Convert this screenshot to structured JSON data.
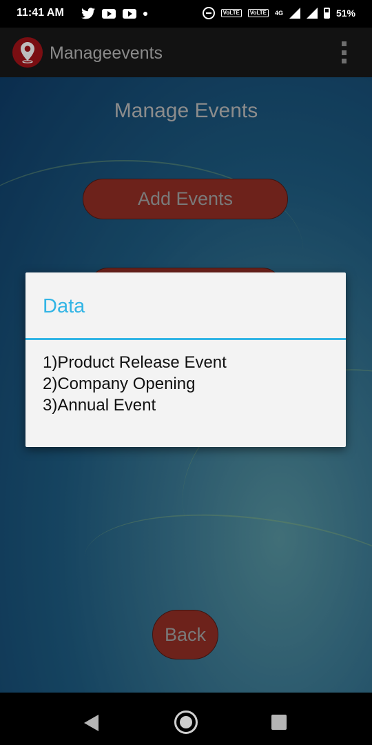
{
  "status_bar": {
    "time": "11:41 AM",
    "battery_text": "51%",
    "network_label": "4G",
    "volte_1": "VoLTE",
    "volte_2": "VoLTE",
    "icons": [
      "twitter-icon",
      "youtube-icon",
      "youtube-icon",
      "notification-dot",
      "do-not-disturb-icon",
      "volte-icon",
      "volte-icon",
      "signal-icon",
      "signal-icon",
      "battery-icon"
    ]
  },
  "app_bar": {
    "title": "Manageevents",
    "logo_icon": "location-pin-icon",
    "menu_icon": "overflow-menu-icon"
  },
  "main": {
    "page_title": "Manage Events",
    "add_button_label": "Add Events",
    "back_button_label": "Back"
  },
  "dialog": {
    "title": "Data",
    "lines": [
      "1)Product Release Event",
      "2)Company Opening",
      "3)Annual Event"
    ]
  },
  "nav_bar": {
    "icons": [
      "back-icon",
      "home-icon",
      "recents-icon"
    ]
  },
  "colors": {
    "dialog_accent": "#33b5e5",
    "button_fill": "#6d221b",
    "app_bar": "#121212"
  }
}
